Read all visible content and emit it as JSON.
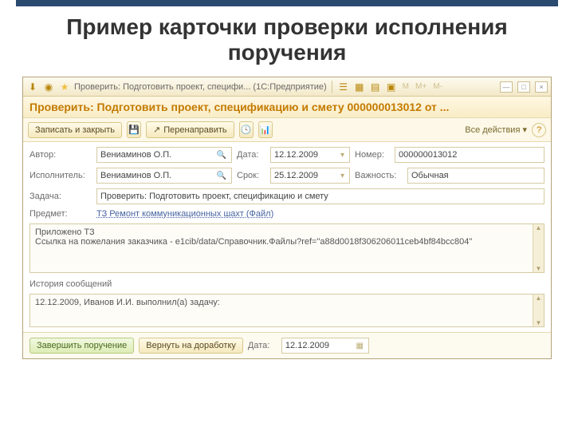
{
  "slide_title": "Пример карточки проверки исполнения поручения",
  "titlebar": {
    "text": "Проверить: Подготовить проект, специфи... (1С:Предприятие)",
    "mem": [
      "M",
      "M+",
      "M-"
    ]
  },
  "window_ctrl": {
    "min": "—",
    "max": "□",
    "close": "×"
  },
  "doc_title": "Проверить: Подготовить проект, спецификацию и смету 000000013012 от ...",
  "toolbar": {
    "save_close": "Записать и закрыть",
    "redirect": "Перенаправить",
    "all_actions": "Все действия ▾"
  },
  "form": {
    "author_lbl": "Автор:",
    "author": "Вениаминов О.П.",
    "date_lbl": "Дата:",
    "date": "12.12.2009",
    "number_lbl": "Номер:",
    "number": "000000013012",
    "exec_lbl": "Исполнитель:",
    "exec": "Вениаминов О.П.",
    "due_lbl": "Срок:",
    "due": "25.12.2009",
    "priority_lbl": "Важность:",
    "priority": "Обычная",
    "task_lbl": "Задача:",
    "task": "Проверить: Подготовить проект, спецификацию и смету",
    "subject_lbl": "Предмет:",
    "subject": "ТЗ Ремонт коммуникационных шахт (Файл)",
    "body_line1": "Приложено ТЗ",
    "body_line2": "Ссылка на пожелания заказчика - e1cib/data/Справочник.Файлы?ref=\"a88d0018f306206011ceb4bf84bcc804\"",
    "history_lbl": "История сообщений",
    "history": "12.12.2009, Иванов И.И. выполнил(а) задачу:"
  },
  "footer": {
    "complete": "Завершить поручение",
    "return": "Вернуть на доработку",
    "date_lbl": "Дата:",
    "date": "12.12.2009"
  }
}
